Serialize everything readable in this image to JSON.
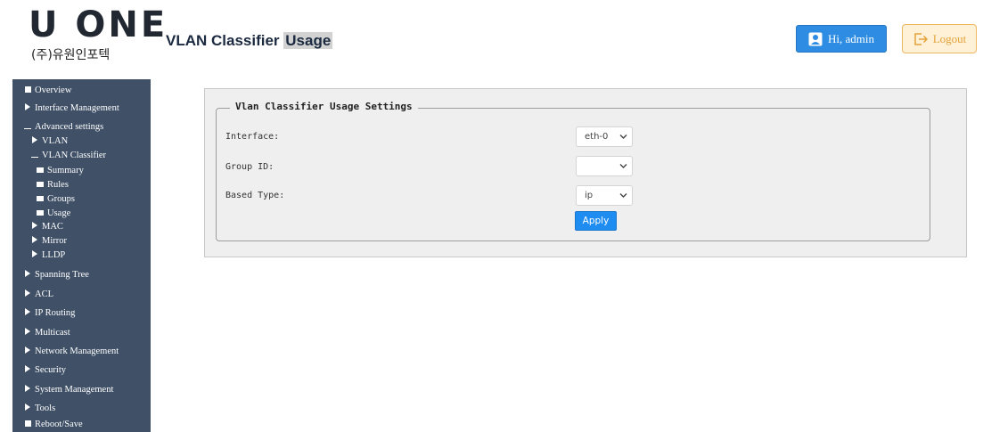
{
  "header": {
    "logo_main": "U ONE",
    "logo_sub": "(주)유원인포텍",
    "title_main": "VLAN Classifier",
    "title_highlight": "Usage",
    "user_label": "Hi, admin",
    "logout_label": "Logout"
  },
  "sidebar": {
    "items": [
      {
        "label": "Overview",
        "marker": "square"
      },
      {
        "label": "Interface Management",
        "marker": "triangle"
      },
      {
        "label": "Advanced settings",
        "marker": "dash"
      },
      {
        "label": "VLAN",
        "marker": "triangle"
      },
      {
        "label": "VLAN Classifier",
        "marker": "dash"
      },
      {
        "label": "Summary",
        "marker": "small-square"
      },
      {
        "label": "Rules",
        "marker": "small-square"
      },
      {
        "label": "Groups",
        "marker": "small-square"
      },
      {
        "label": "Usage",
        "marker": "small-square"
      },
      {
        "label": "MAC",
        "marker": "triangle"
      },
      {
        "label": "Mirror",
        "marker": "triangle"
      },
      {
        "label": "LLDP",
        "marker": "triangle"
      },
      {
        "label": "Spanning Tree",
        "marker": "triangle"
      },
      {
        "label": "ACL",
        "marker": "triangle"
      },
      {
        "label": "IP Routing",
        "marker": "triangle"
      },
      {
        "label": "Multicast",
        "marker": "triangle"
      },
      {
        "label": "Network Management",
        "marker": "triangle"
      },
      {
        "label": "Security",
        "marker": "triangle"
      },
      {
        "label": "System Management",
        "marker": "triangle"
      },
      {
        "label": "Tools",
        "marker": "triangle"
      },
      {
        "label": "Reboot/Save",
        "marker": "square"
      }
    ]
  },
  "settings": {
    "legend": "Vlan Classifier Usage Settings",
    "fields": [
      {
        "label": "Interface:",
        "value": "eth-0"
      },
      {
        "label": "Group ID:",
        "value": ""
      },
      {
        "label": "Based Type:",
        "value": "ip"
      }
    ],
    "apply_label": "Apply"
  },
  "colors": {
    "sidebar_bg": "#3f5067",
    "accent_blue": "#1e8cf0",
    "logout_orange": "#e3a23a"
  },
  "icons": {
    "user": "user-badge-icon",
    "logout": "logout-arrow-icon",
    "dropdown": "chevron-down-icon"
  }
}
